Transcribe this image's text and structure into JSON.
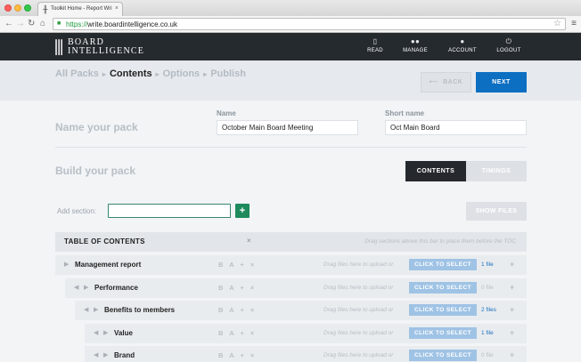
{
  "browser": {
    "tab_title": "Toolkit Home - Report Wri",
    "url_scheme": "https://",
    "url_host": "write.boardintelligence.co.uk"
  },
  "header": {
    "logo_top": "BOARD",
    "logo_bottom": "INTELLIGENCE",
    "nav": [
      {
        "label": "READ",
        "icon": "book-icon"
      },
      {
        "label": "MANAGE",
        "icon": "users-icon"
      },
      {
        "label": "ACCOUNT",
        "icon": "user-icon"
      },
      {
        "label": "LOGOUT",
        "icon": "power-icon"
      }
    ]
  },
  "breadcrumbs": [
    "All Packs",
    "Contents",
    "Options",
    "Publish"
  ],
  "breadcrumb_active_index": 1,
  "actions": {
    "back": "BACK",
    "next": "NEXT"
  },
  "name_section": {
    "title": "Name your pack",
    "name_label": "Name",
    "name_value": "October Main Board Meeting",
    "short_label": "Short name",
    "short_value": "Oct Main Board"
  },
  "build_section": {
    "title": "Build your pack",
    "tab_contents": "CONTENTS",
    "tab_timings": "TIMINGS",
    "add_section_label": "Add section:",
    "add_section_value": "",
    "add_button": "+",
    "show_files": "SHOW FILES"
  },
  "toc": {
    "title": "TABLE OF CONTENTS",
    "remove": "×",
    "hint": "Drag sections above this bar to place them before the TOC"
  },
  "row_tools": "B A + ×",
  "drag_hint": "Drag files here to upload or",
  "select_label": "CLICK TO SELECT",
  "add_after": "+",
  "sections": [
    {
      "title": "Management report",
      "depth": 0,
      "files": "1 file",
      "has_files": true
    },
    {
      "title": "Performance",
      "depth": 1,
      "files": "0 file",
      "has_files": false
    },
    {
      "title": "Benefits to members",
      "depth": 2,
      "files": "2 files",
      "has_files": true
    },
    {
      "title": "Value",
      "depth": 3,
      "files": "1 file",
      "has_files": true
    },
    {
      "title": "Brand",
      "depth": 3,
      "files": "0 file",
      "has_files": false
    }
  ],
  "colors": {
    "header_bg": "#252a2f",
    "primary_blue": "#0d6fc2",
    "add_green": "#1e8a5e",
    "select_blue": "#9fc3e5",
    "file_link": "#1b6fbe"
  }
}
